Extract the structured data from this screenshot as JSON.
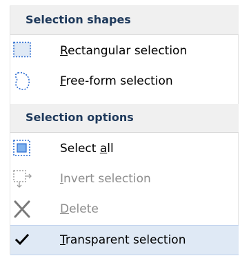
{
  "menu": {
    "sections": [
      {
        "header": "Selection shapes",
        "items": [
          {
            "label_pre": "",
            "accel": "R",
            "label_post": "ectangular selection",
            "icon": "rectangular-selection-icon"
          },
          {
            "label_pre": "",
            "accel": "F",
            "label_post": "ree-form selection",
            "icon": "free-form-selection-icon"
          }
        ]
      },
      {
        "header": "Selection options",
        "items": [
          {
            "label_pre": "Select ",
            "accel": "a",
            "label_post": "ll",
            "icon": "select-all-icon"
          },
          {
            "label_pre": "",
            "accel": "I",
            "label_post": "nvert selection",
            "icon": "invert-selection-icon",
            "disabled": true
          },
          {
            "label_pre": "",
            "accel": "D",
            "label_post": "elete",
            "icon": "delete-icon",
            "disabled": true
          },
          {
            "label_pre": "",
            "accel": "T",
            "label_post": "ransparent selection",
            "icon": "checkmark-icon",
            "checked": true
          }
        ]
      }
    ]
  },
  "colors": {
    "header_bg": "#f0f0f0",
    "header_text": "#1e395b",
    "checked_bg": "#dfe9f5",
    "icon_accent": "#2a6bd1",
    "disabled_text": "#8d8d8d"
  }
}
